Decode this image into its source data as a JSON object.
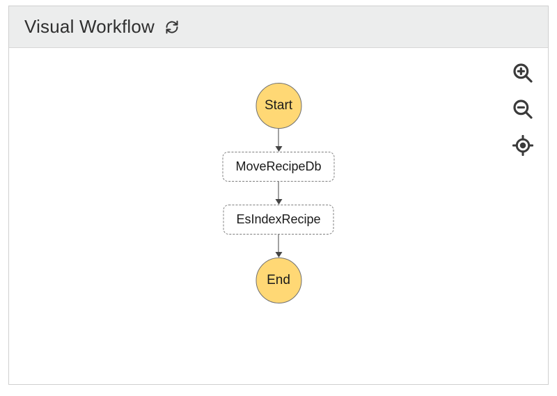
{
  "header": {
    "title": "Visual Workflow"
  },
  "controls": {
    "refresh": "refresh",
    "zoom_in": "zoom-in",
    "zoom_out": "zoom-out",
    "recenter": "recenter"
  },
  "workflow": {
    "start_label": "Start",
    "end_label": "End",
    "steps": [
      {
        "label": "MoveRecipeDb"
      },
      {
        "label": "EsIndexRecipe"
      }
    ]
  }
}
